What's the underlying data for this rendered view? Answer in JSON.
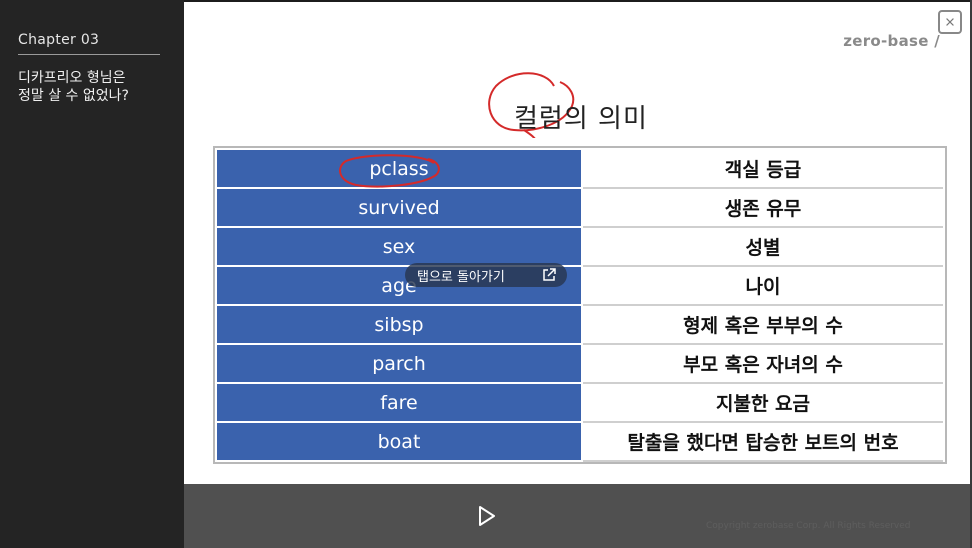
{
  "sidebar": {
    "chapter": "Chapter   03",
    "lesson_line1": "디카프리오 형님은",
    "lesson_line2": "정말 살 수 없었나?"
  },
  "slide": {
    "brand": "zero-base /",
    "title": "컬럼의 의미",
    "table": [
      {
        "name": "pclass",
        "meaning": "객실 등급"
      },
      {
        "name": "survived",
        "meaning": "생존 유무"
      },
      {
        "name": "sex",
        "meaning": "성별"
      },
      {
        "name": "age",
        "meaning": "나이"
      },
      {
        "name": "sibsp",
        "meaning": "형제 혹은 부부의 수"
      },
      {
        "name": "parch",
        "meaning": "부모 혹은 자녀의 수"
      },
      {
        "name": "fare",
        "meaning": "지불한 요금"
      },
      {
        "name": "boat",
        "meaning": "탈출을 했다면 탑승한 보트의 번호"
      }
    ]
  },
  "overlay": {
    "back_to_tab": "탭으로 돌아가기",
    "icon": "external-link-icon"
  },
  "controls": {
    "play_icon": "play-icon",
    "copyright": "Copyright zerobase Corp. All Rights Reserved"
  },
  "close_icon": "close-icon",
  "colors": {
    "table_header_blue": "#3a62ad",
    "annotation_red": "#d42a2a",
    "sidebar_bg": "#242424",
    "control_bar": "#505050"
  }
}
